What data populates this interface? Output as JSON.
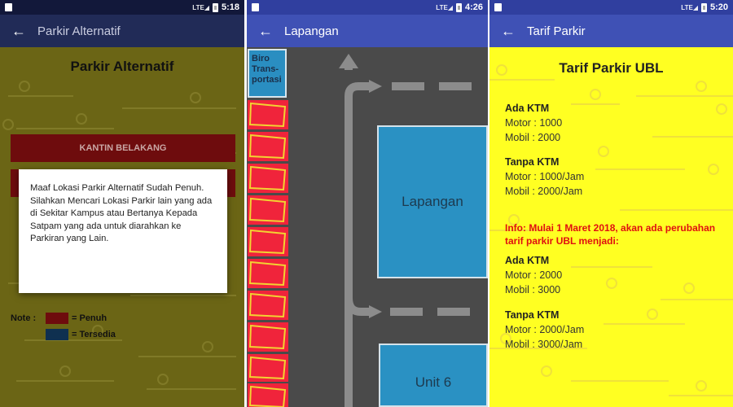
{
  "screens": {
    "alternatif": {
      "status_time": "5:18",
      "appbar_title": "Parkir Alternatif",
      "heading": "Parkir Alternatif",
      "buttons": [
        "KANTIN BELAKANG"
      ],
      "dialog_message": "Maaf Lokasi Parkir Alternatif Sudah Penuh. Silahkan Mencari Lokasi Parkir lain yang ada di Sekitar Kampus atau Bertanya Kepada Satpam yang ada untuk diarahkan ke Parkiran yang Lain.",
      "legend": {
        "note_label": "Note :",
        "penuh_label": "= Penuh",
        "tersedia_label": "= Tersedia",
        "penuh_color": "#cc1111",
        "tersedia_color": "#1d5f99"
      }
    },
    "lapangan": {
      "status_time": "4:26",
      "appbar_title": "Lapangan",
      "biro_label": "Biro\nTrans-\nportasi",
      "building_lapangan": "Lapangan",
      "building_unit": "Unit 6",
      "slot_color": "#f0243b",
      "slot_count": 10
    },
    "tarif": {
      "status_time": "5:20",
      "appbar_title": "Tarif Parkir",
      "heading": "Tarif Parkir UBL",
      "current": {
        "ktm_heading": "Ada KTM",
        "ktm_motor": "Motor : 1000",
        "ktm_mobil": "Mobil  : 2000",
        "noktm_heading": "Tanpa KTM",
        "noktm_motor": "Motor : 1000/Jam",
        "noktm_mobil": "Mobil  : 2000/Jam"
      },
      "info": "Info: Mulai 1 Maret 2018, akan ada perubahan tarif parkir UBL menjadi:",
      "new": {
        "ktm_heading": "Ada KTM",
        "ktm_motor": "Motor : 2000",
        "ktm_mobil": "Mobil  : 3000",
        "noktm_heading": "Tanpa KTM",
        "noktm_motor": "Motor : 2000/Jam",
        "noktm_mobil": "Mobil  : 3000/Jam"
      }
    }
  },
  "icons": {
    "back": "arrow-left-icon",
    "battery": "battery-icon",
    "signal": "signal-icon"
  },
  "colors": {
    "primary": "#3f51b5",
    "primary_dark": "#303f9f",
    "tarif_bg": "#ffff22",
    "info_red": "#e01010"
  }
}
